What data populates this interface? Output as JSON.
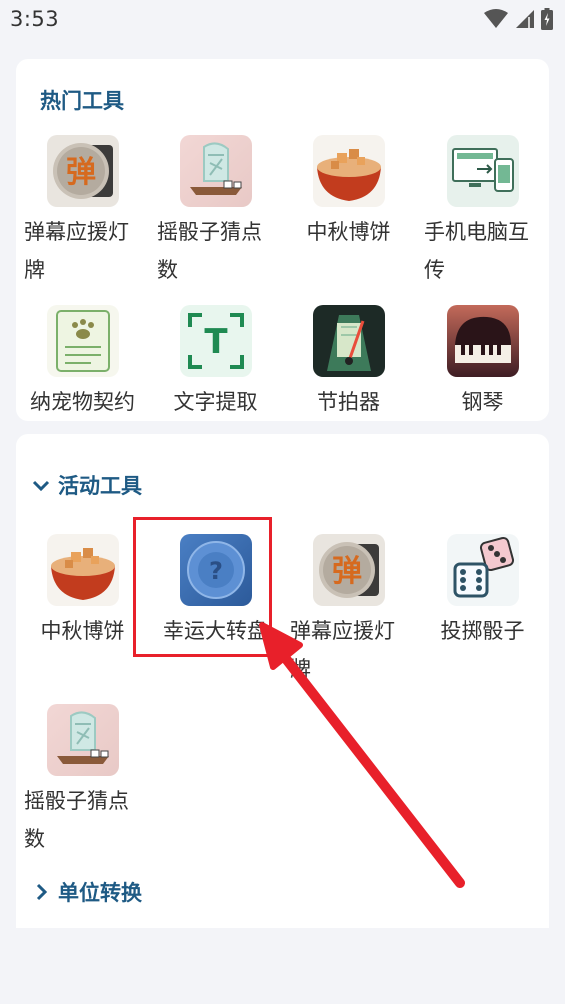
{
  "status_bar": {
    "time": "3:53"
  },
  "hot_tools": {
    "title": "热门工具",
    "items": [
      {
        "label": "弹幕应援灯牌",
        "glyph": "弹"
      },
      {
        "label": "摇骰子猜点数"
      },
      {
        "label": "中秋博饼"
      },
      {
        "label": "手机电脑互传"
      },
      {
        "label": "纳宠物契约"
      },
      {
        "label": "文字提取",
        "glyph": "T"
      },
      {
        "label": "节拍器"
      },
      {
        "label": "钢琴"
      }
    ]
  },
  "activity_tools": {
    "title": "活动工具",
    "items": [
      {
        "label": "中秋博饼"
      },
      {
        "label": "幸运大转盘",
        "glyph": "?"
      },
      {
        "label": "弹幕应援灯牌",
        "glyph": "弹"
      },
      {
        "label": "投掷骰子"
      },
      {
        "label": "摇骰子猜点数"
      }
    ]
  },
  "unit_conversion": {
    "title": "单位转换"
  },
  "colors": {
    "accent": "#1e5a84",
    "annotation": "#e8202a",
    "background": "#f3f4f8"
  }
}
